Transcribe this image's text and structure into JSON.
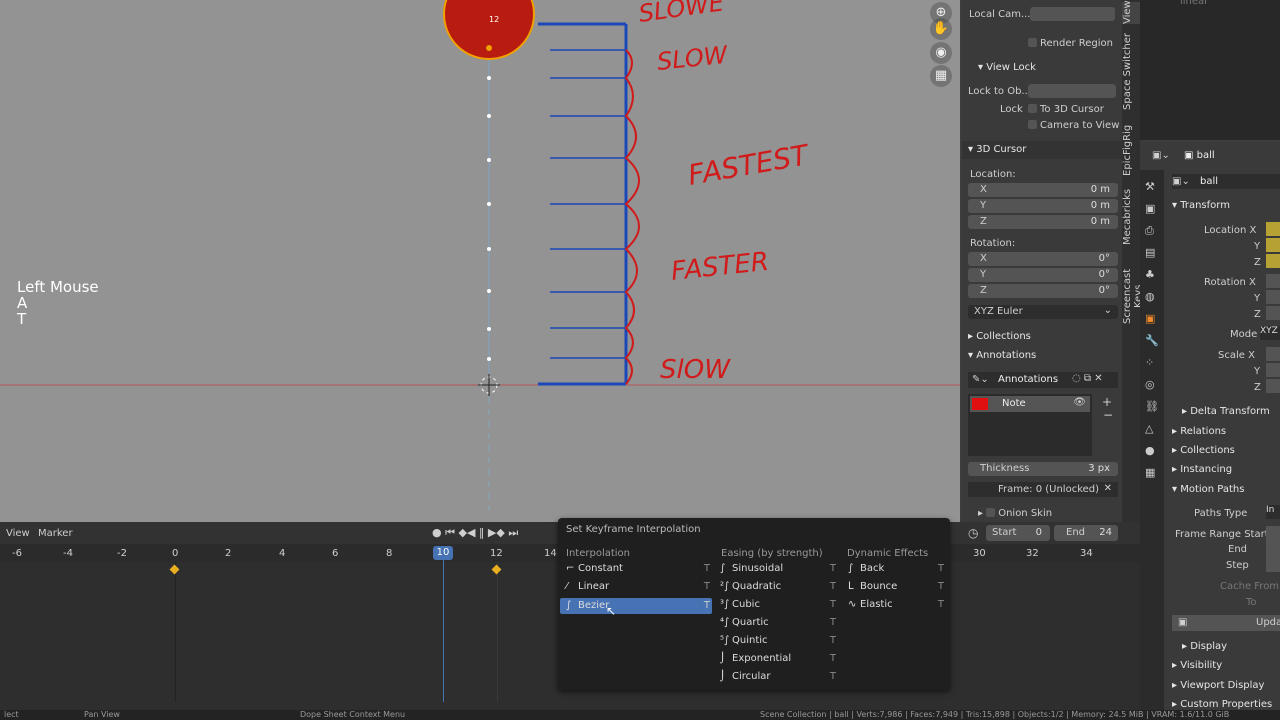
{
  "viewport": {
    "overlay_lines": [
      "Left Mouse",
      "A",
      "T"
    ],
    "ball_frame_label": "12",
    "annotations": [
      "SLOWE",
      "SLOW",
      "FASTEST",
      "FASTER",
      "SlOW"
    ],
    "gizmo_icons": [
      "zoom-icon",
      "hand-icon",
      "camera-icon",
      "grid-icon"
    ]
  },
  "npanel": {
    "local_camera_label": "Local Cam...",
    "render_region_label": "Render Region",
    "view_lock_header": "View Lock",
    "lock_to_object_label": "Lock to Ob...",
    "lock_label": "Lock",
    "to_3d_cursor_label": "To 3D Cursor",
    "camera_to_view_label": "Camera to View",
    "cursor_header": "3D Cursor",
    "location_label": "Location:",
    "location": [
      {
        "axis": "X",
        "value": "0 m"
      },
      {
        "axis": "Y",
        "value": "0 m"
      },
      {
        "axis": "Z",
        "value": "0 m"
      }
    ],
    "rotation_label": "Rotation:",
    "rotation": [
      {
        "axis": "X",
        "value": "0°"
      },
      {
        "axis": "Y",
        "value": "0°"
      },
      {
        "axis": "Z",
        "value": "0°"
      }
    ],
    "rotation_mode": "XYZ Euler",
    "collections_header": "Collections",
    "annotations_header": "Annotations",
    "annotations_dropdown": "Annotations",
    "layer_name": "Note",
    "thickness_label": "Thickness",
    "thickness_value": "3 px",
    "frame_label": "Frame: 0 (Unlocked)",
    "onion_skin_label": "Onion Skin"
  },
  "tabs": [
    "View",
    "Space Switcher",
    "EpicFigRig",
    "Mecabricks",
    "Screencast Keys"
  ],
  "outliner": {
    "label": "linear"
  },
  "properties": {
    "object_name": "ball",
    "object_name2": "ball",
    "transform_header": "Transform",
    "location_x_label": "Location X",
    "y_label": "Y",
    "z_label": "Z",
    "rotation_x_label": "Rotation X",
    "mode_label": "Mode",
    "mode_value": "XYZ",
    "scale_x_label": "Scale X",
    "delta_transform_label": "Delta Transform",
    "relations_label": "Relations",
    "collections_label": "Collections",
    "instancing_label": "Instancing",
    "motion_paths_label": "Motion Paths",
    "paths_type_label": "Paths Type",
    "paths_type_value": "In",
    "frame_range_start_label": "Frame Range Start",
    "end_label": "End",
    "step_label": "Step",
    "cache_from_label": "Cache From",
    "to_label": "To",
    "update_label": "Upda",
    "display_label": "Display",
    "visibility_label": "Visibility",
    "viewport_display_label": "Viewport Display",
    "custom_properties_label": "Custom Properties"
  },
  "timeline": {
    "menu_view": "View",
    "menu_marker": "Marker",
    "start_label": "Start",
    "start_value": "0",
    "end_label": "End",
    "end_value": "24",
    "ruler": [
      "-6",
      "-4",
      "-2",
      "0",
      "2",
      "4",
      "6",
      "8",
      "10",
      "12",
      "14",
      "30",
      "32",
      "34"
    ],
    "current_frame": "10",
    "keyframe_frames": [
      0,
      12
    ]
  },
  "menu": {
    "title": "Set Keyframe Interpolation",
    "col1_header": "Interpolation",
    "col2_header": "Easing (by strength)",
    "col3_header": "Dynamic Effects",
    "interpolation": [
      "Constant",
      "Linear",
      "Bezier"
    ],
    "easing": [
      "Sinusoidal",
      "Quadratic",
      "Cubic",
      "Quartic",
      "Quintic",
      "Exponential",
      "Circular"
    ],
    "dynamic": [
      "Back",
      "Bounce",
      "Elastic"
    ],
    "shortcut": "T",
    "selected": "Bezier"
  },
  "statusbar": {
    "left": "lect",
    "pan_view": "Pan View",
    "context_menu": "Dope Sheet Context Menu",
    "stats": "Scene Collection | ball | Verts:7,986 | Faces:7,949 | Tris:15,898 | Objects:1/2 | Memory: 24.5 MiB | VRAM: 1.6/11.0 GiB"
  },
  "colors": {
    "accent": "#4772b3",
    "annotation": "#d11a1a",
    "keyframe": "#e8b021",
    "panel": "#3a3a3a"
  }
}
